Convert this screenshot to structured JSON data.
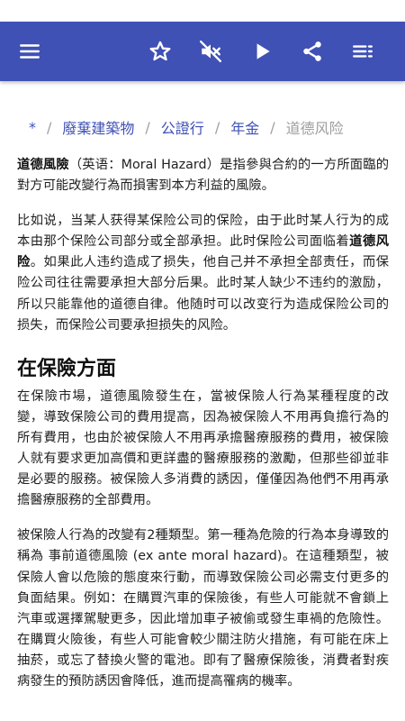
{
  "toolbar": {
    "menu_icon": "menu-icon",
    "star_icon": "star-outline-icon",
    "mute_icon": "volume-off-icon",
    "play_icon": "play-icon",
    "share_icon": "share-icon",
    "list_icon": "playlist-icon"
  },
  "breadcrumb": [
    "*",
    "廢棄建築物",
    "公證行",
    "年金",
    "道德风险"
  ],
  "intro": {
    "term": "道德風險",
    "rest": "（英语：Moral Hazard）是指參與合約的一方所面臨的對方可能改變行為而損害到本方利益的風險。"
  },
  "para2": {
    "before": "比如说，当某人获得某保险公司的保险，由于此时某人行为的成本由那个保险公司部分或全部承担。此时保险公司面临着",
    "bold": "道德风险",
    "after": "。如果此人违约造成了损失，他自己并不承担全部责任，而保险公司往往需要承担大部分后果。此时某人缺少不违约的激励，所以只能靠他的道德自律。他随时可以改变行为造成保险公司的损失，而保险公司要承担损失的风险。"
  },
  "section1": {
    "heading": "在保險方面",
    "p1": "在保險市場，道德風險發生在，當被保險人行為某種程度的改變，導致保險公司的費用提高，因為被保險人不用再負擔行為的所有費用，也由於被保險人不用再承擔醫療服務的費用，被保險人就有要求更加高價和更詳盡的醫療服務的激勵，但那些卻並非是必要的服務。被保險人多消費的誘因，僅僅因為他們不用再承擔醫療服務的全部費用。",
    "p2": "被保險人行為的改變有2種類型。第一種為危險的行為本身導致的稱為 事前道德風險 (ex ante moral hazard)。在這種類型，被保險人會以危險的態度來行動，而導致保險公司必需支付更多的負面結果。例如：在購買汽車的保險後，有些人可能就不會鎖上汽車或選擇駕駛更多，因此增加車子被偷或發生車禍的危險性。在購買火險後，有些人可能會較少關注防火措施，有可能在床上抽菸，或忘了替換火警的電池。即有了醫療保險後，消費者對疾病發生的預防誘因會降低，進而提高罹病的機率。"
  }
}
